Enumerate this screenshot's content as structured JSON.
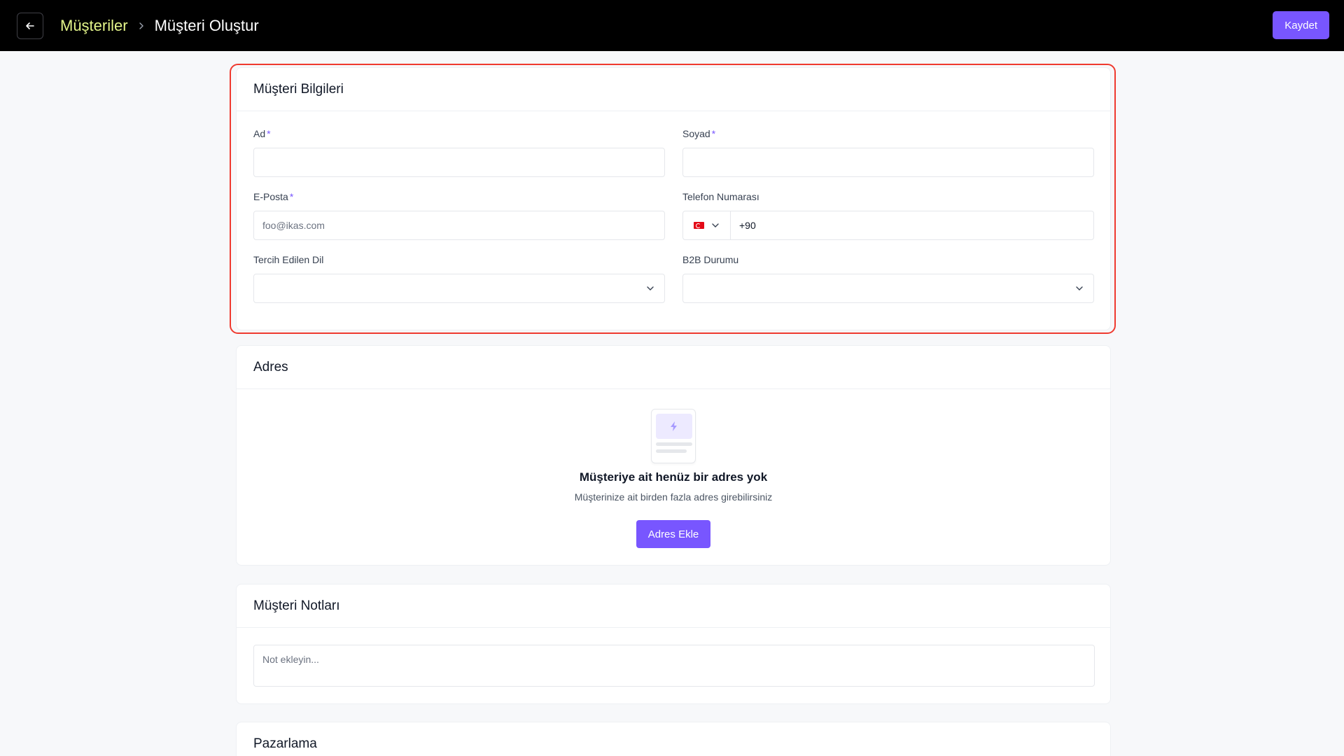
{
  "header": {
    "breadcrumb_parent": "Müşteriler",
    "breadcrumb_current": "Müşteri Oluştur",
    "save_label": "Kaydet"
  },
  "customer_info": {
    "title": "Müşteri Bilgileri",
    "first_name": {
      "label": "Ad",
      "required_mark": "*",
      "value": ""
    },
    "last_name": {
      "label": "Soyad",
      "required_mark": "*",
      "value": ""
    },
    "email": {
      "label": "E-Posta",
      "required_mark": "*",
      "placeholder": "foo@ikas.com",
      "value": ""
    },
    "phone": {
      "label": "Telefon Numarası",
      "country": "TR",
      "value": "+90"
    },
    "preferred_language": {
      "label": "Tercih Edilen Dil",
      "selected": ""
    },
    "b2b_status": {
      "label": "B2B Durumu",
      "selected": ""
    }
  },
  "address": {
    "title": "Adres",
    "empty_title": "Müşteriye ait henüz bir adres yok",
    "empty_subtitle": "Müşterinize ait birden fazla adres girebilirsiniz",
    "add_label": "Adres Ekle"
  },
  "notes": {
    "title": "Müşteri Notları",
    "placeholder": "Not ekleyin..."
  },
  "marketing": {
    "title": "Pazarlama"
  },
  "colors": {
    "accent": "#7856ff",
    "breadcrumb_parent": "#e4f58a",
    "highlight_border": "#ef3a2f"
  }
}
